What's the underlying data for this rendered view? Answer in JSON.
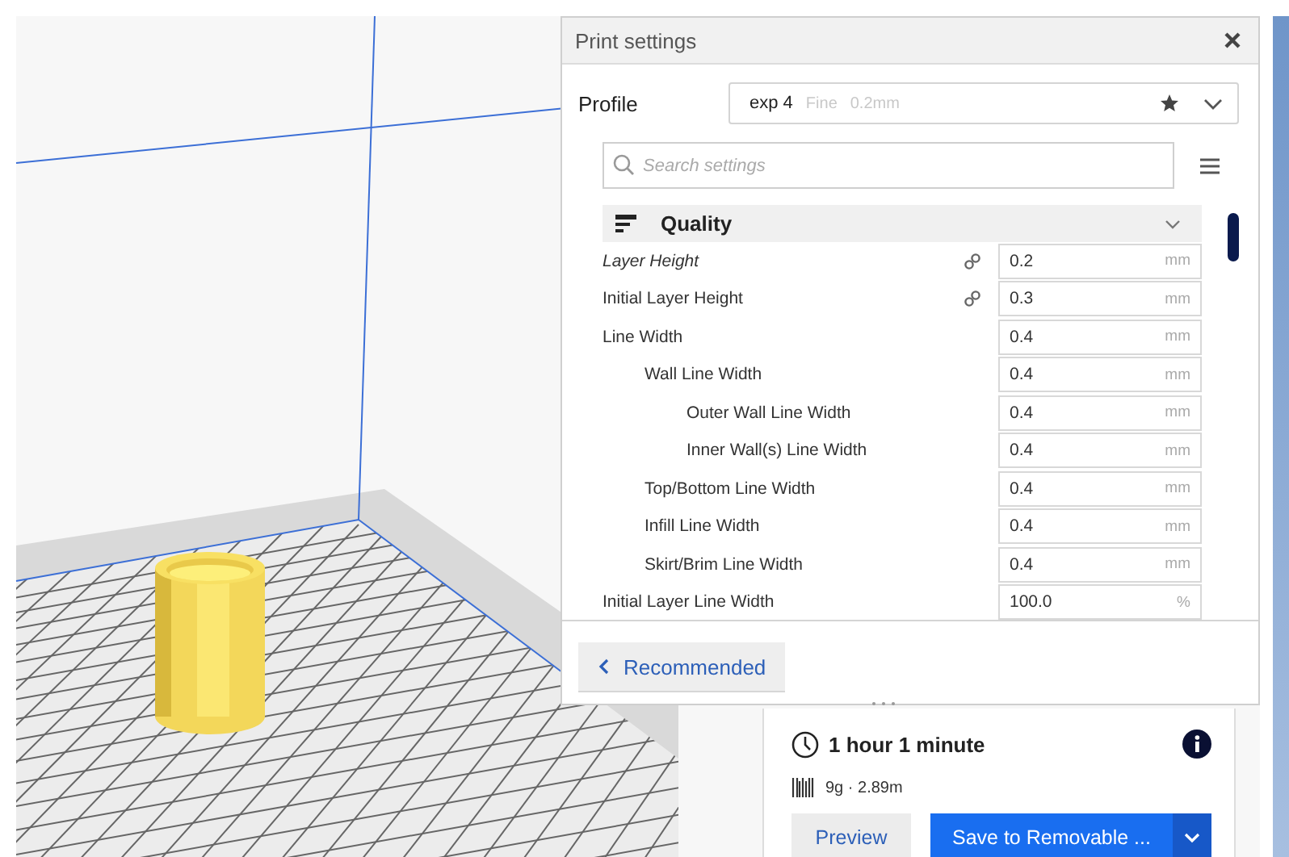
{
  "panel": {
    "title": "Print settings",
    "profile": {
      "label": "Profile",
      "name": "exp 4",
      "quality": "Fine",
      "layer": "0.2mm"
    },
    "search": {
      "placeholder": "Search settings"
    },
    "category": {
      "title": "Quality",
      "expanded": true
    },
    "settings": [
      {
        "label": "Layer Height",
        "modified": true,
        "linked": true,
        "value": "0.2",
        "unit": "mm"
      },
      {
        "label": "Initial Layer Height",
        "modified": false,
        "linked": true,
        "value": "0.3",
        "unit": "mm"
      },
      {
        "label": "Line Width",
        "modified": false,
        "linked": false,
        "value": "0.4",
        "unit": "mm",
        "children": [
          {
            "label": "Wall Line Width",
            "modified": false,
            "linked": false,
            "value": "0.4",
            "unit": "mm",
            "children": [
              {
                "label": "Outer Wall Line Width",
                "modified": false,
                "linked": false,
                "value": "0.4",
                "unit": "mm"
              },
              {
                "label": "Inner Wall(s) Line Width",
                "modified": false,
                "linked": false,
                "value": "0.4",
                "unit": "mm"
              }
            ]
          },
          {
            "label": "Top/Bottom Line Width",
            "modified": false,
            "linked": false,
            "value": "0.4",
            "unit": "mm"
          },
          {
            "label": "Infill Line Width",
            "modified": false,
            "linked": false,
            "value": "0.4",
            "unit": "mm"
          },
          {
            "label": "Skirt/Brim Line Width",
            "modified": false,
            "linked": false,
            "value": "0.4",
            "unit": "mm"
          }
        ]
      },
      {
        "label": "Initial Layer Line Width",
        "modified": false,
        "linked": false,
        "value": "100.0",
        "unit": "%"
      }
    ],
    "recommended_button": "Recommended"
  },
  "summary": {
    "time": "1 hour 1 minute",
    "material": "9g · 2.89m",
    "preview_button": "Preview",
    "save_button": "Save to Removable ..."
  }
}
